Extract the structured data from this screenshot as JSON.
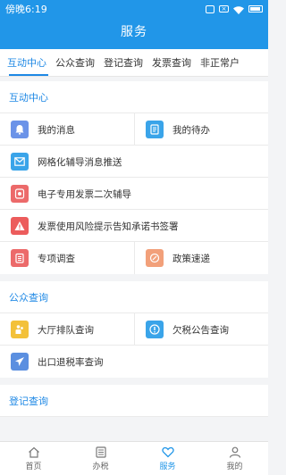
{
  "status_bar": {
    "time": "傍晚6:19",
    "icons": [
      "nfc-icon",
      "close-box-icon",
      "wifi-icon",
      "battery-icon"
    ]
  },
  "header": {
    "title": "服务"
  },
  "tabs": [
    {
      "label": "互动中心",
      "active": true
    },
    {
      "label": "公众查询",
      "active": false
    },
    {
      "label": "登记查询",
      "active": false
    },
    {
      "label": "发票查询",
      "active": false
    },
    {
      "label": "非正常户",
      "active": false
    }
  ],
  "sections": {
    "interaction": {
      "title": "互动中心",
      "items": {
        "messages": {
          "label": "我的消息",
          "icon": "bell-icon",
          "color": "#6b93e8"
        },
        "todo": {
          "label": "我的待办",
          "icon": "document-icon",
          "color": "#3aa4e9"
        },
        "grid_push": {
          "label": "网格化辅导消息推送",
          "icon": "mail-icon",
          "color": "#3aa4e9"
        },
        "einvoice": {
          "label": "电子专用发票二次辅导",
          "icon": "invoice-icon",
          "color": "#ec6a6a"
        },
        "risk": {
          "label": "发票使用风险提示告知承诺书签署",
          "icon": "warning-icon",
          "color": "#ec5c5c"
        },
        "survey": {
          "label": "专项调查",
          "icon": "clipboard-icon",
          "color": "#ec6a6a"
        },
        "policy": {
          "label": "政策速递",
          "icon": "policy-icon",
          "color": "#f2a07a"
        }
      }
    },
    "public": {
      "title": "公众查询",
      "items": {
        "queue": {
          "label": "大厅排队查询",
          "icon": "queue-icon",
          "color": "#f3c13a"
        },
        "arrears": {
          "label": "欠税公告查询",
          "icon": "alert-icon",
          "color": "#3aa4e9"
        },
        "export_rate": {
          "label": "出口退税率查询",
          "icon": "airplane-icon",
          "color": "#5b8fe0"
        }
      }
    },
    "registration": {
      "title": "登记查询"
    }
  },
  "bottom_nav": [
    {
      "label": "首页",
      "icon": "home-icon",
      "active": false
    },
    {
      "label": "办税",
      "icon": "list-icon",
      "active": false
    },
    {
      "label": "服务",
      "icon": "heart-icon",
      "active": true
    },
    {
      "label": "我的",
      "icon": "user-icon",
      "active": false
    }
  ],
  "colors": {
    "primary": "#2196e8",
    "accent_text": "#1e88e5",
    "background": "#f3f4f6"
  }
}
